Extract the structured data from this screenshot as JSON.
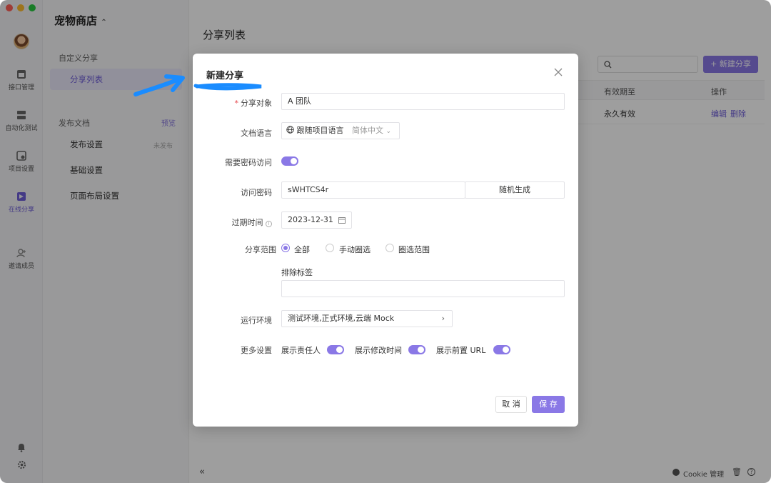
{
  "window": {
    "traffic_colors": [
      "#ff5f57",
      "#febc2e",
      "#28c840"
    ]
  },
  "rail": {
    "items": [
      {
        "label": "接口管理",
        "icon": "api-icon"
      },
      {
        "label": "自动化测试",
        "icon": "automation-icon"
      },
      {
        "label": "项目设置",
        "icon": "project-settings-icon"
      },
      {
        "label": "在线分享",
        "icon": "online-share-icon",
        "active": true
      },
      {
        "label": "邀请成员",
        "icon": "invite-member-icon"
      }
    ]
  },
  "sidebar": {
    "project_name": "宠物商店",
    "custom_share_heading": "自定义分享",
    "share_list_item": "分享列表",
    "publish_heading": "发布文档",
    "publish_preview": "预览",
    "publish_settings": "发布设置",
    "unpublished": "未发布",
    "basic_settings": "基础设置",
    "layout_settings": "页面布局设置"
  },
  "main": {
    "title": "分享列表",
    "new_share_button": "+ 新建分享",
    "table_headers": [
      "有效期至",
      "操作"
    ],
    "row": {
      "expiry": "永久有效",
      "edit": "编辑",
      "delete": "删除"
    },
    "cookie_label": "Cookie 管理"
  },
  "modal": {
    "title": "新建分享",
    "fields": {
      "share_target": {
        "label": "分享对象",
        "value": "A 团队"
      },
      "doc_language": {
        "label": "文档语言",
        "value": "跟随项目语言",
        "secondary": "简体中文"
      },
      "need_password": {
        "label": "需要密码访问",
        "on": true
      },
      "password": {
        "label": "访问密码",
        "value": "sWHTCS4r",
        "generate": "随机生成"
      },
      "expiry": {
        "label": "过期时间",
        "value": "2023-12-31"
      },
      "scope": {
        "label": "分享范围",
        "options": [
          "全部",
          "手动圈选",
          "圈选范围"
        ],
        "selected": "全部"
      },
      "exclude_tags": {
        "label": "排除标签",
        "value": ""
      },
      "env": {
        "label": "运行环境",
        "value": "测试环境,正式环境,云端 Mock"
      },
      "more": {
        "label": "更多设置",
        "show_owner": "展示责任人",
        "show_modified": "展示修改时间",
        "show_base_url": "展示前置 URL"
      }
    },
    "cancel": "取 消",
    "save": "保 存"
  },
  "colors": {
    "accent": "#8a78e6",
    "annotation": "#1a8cff"
  }
}
